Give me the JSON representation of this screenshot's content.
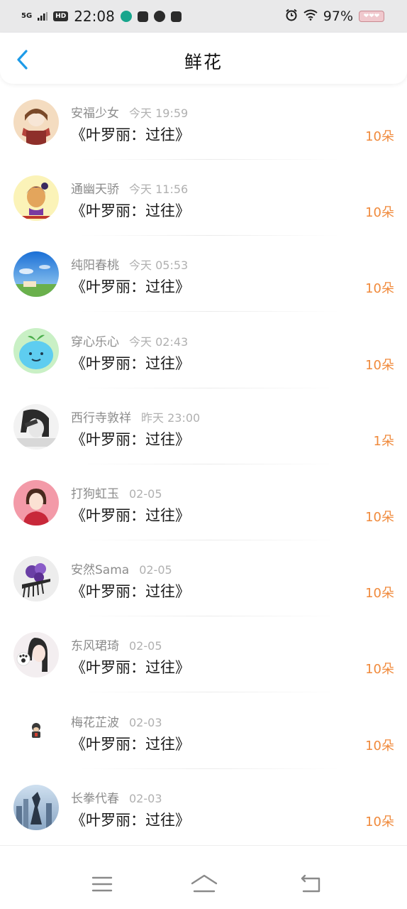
{
  "status_bar": {
    "network": "5G",
    "hd": "HD",
    "time": "22:08",
    "battery": "97%",
    "battery_icon_text": "❤❤❤"
  },
  "header": {
    "title": "鲜花"
  },
  "items": [
    {
      "name": "安福少女",
      "time": "今天 19:59",
      "book": "《叶罗丽：过往》",
      "flowers": "10朵"
    },
    {
      "name": "通幽天骄",
      "time": "今天 11:56",
      "book": "《叶罗丽：过往》",
      "flowers": "10朵"
    },
    {
      "name": "纯阳春桃",
      "time": "今天 05:53",
      "book": "《叶罗丽：过往》",
      "flowers": "10朵"
    },
    {
      "name": "穿心乐心",
      "time": "今天 02:43",
      "book": "《叶罗丽：过往》",
      "flowers": "10朵"
    },
    {
      "name": "西行寺敦祥",
      "time": "昨天 23:00",
      "book": "《叶罗丽：过往》",
      "flowers": "1朵"
    },
    {
      "name": "打狗虹玉",
      "time": "02-05",
      "book": "《叶罗丽：过往》",
      "flowers": "10朵"
    },
    {
      "name": "安然Sama",
      "time": "02-05",
      "book": "《叶罗丽：过往》",
      "flowers": "10朵"
    },
    {
      "name": "东风珺琦",
      "time": "02-05",
      "book": "《叶罗丽：过往》",
      "flowers": "10朵"
    },
    {
      "name": "梅花芷波",
      "time": "02-03",
      "book": "《叶罗丽：过往》",
      "flowers": "10朵"
    },
    {
      "name": "长拳代春",
      "time": "02-03",
      "book": "《叶罗丽：过往》",
      "flowers": "10朵"
    }
  ],
  "icons": {
    "back": "chevron-left-icon",
    "menu": "menu-icon",
    "home": "home-icon",
    "return": "return-icon"
  },
  "colors": {
    "accent": "#1e9be8",
    "flowers": "#f08a3c",
    "status_bar_bg": "#e9e9ea"
  }
}
